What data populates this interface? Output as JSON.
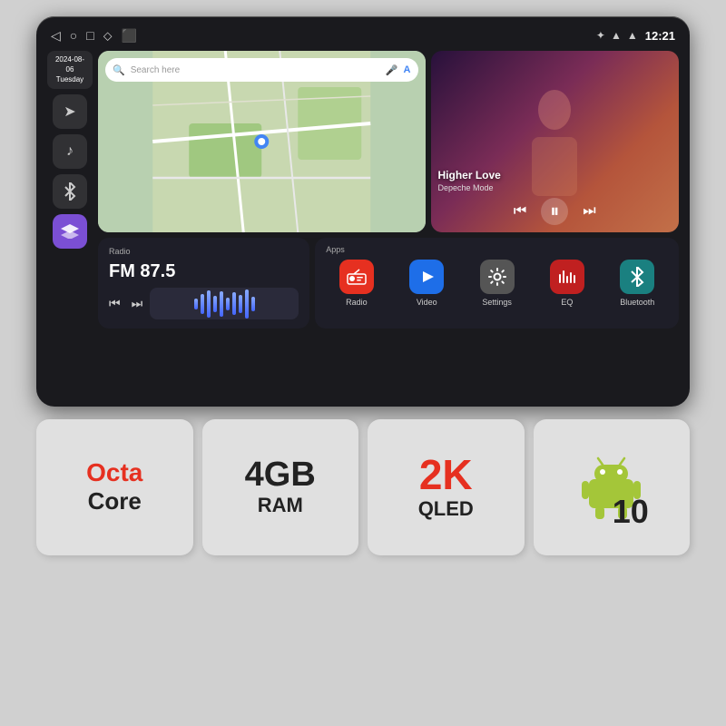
{
  "statusBar": {
    "time": "12:21",
    "navIcons": [
      "◁",
      "○",
      "□",
      "⬦",
      "⬛"
    ],
    "statusIcons": [
      "✦",
      "▲",
      "▲"
    ]
  },
  "sidebar": {
    "date": "2024-08-06",
    "dayName": "Tuesday",
    "buttons": [
      {
        "id": "send",
        "icon": "➤",
        "active": false
      },
      {
        "id": "music",
        "icon": "♪",
        "active": false
      },
      {
        "id": "bluetooth",
        "icon": "⚡",
        "active": false
      },
      {
        "id": "layers",
        "icon": "⧉",
        "active": true,
        "style": "purple"
      }
    ]
  },
  "map": {
    "searchPlaceholder": "Search here"
  },
  "music": {
    "title": "Higher Love",
    "artist": "Depeche Mode"
  },
  "radio": {
    "label": "Radio",
    "frequency": "FM 87.5"
  },
  "apps": {
    "label": "Apps",
    "items": [
      {
        "id": "radio",
        "label": "Radio",
        "colorClass": "red",
        "icon": "📻"
      },
      {
        "id": "video",
        "label": "Video",
        "colorClass": "blue",
        "icon": "▶"
      },
      {
        "id": "settings",
        "label": "Settings",
        "colorClass": "gray",
        "icon": "⚙"
      },
      {
        "id": "eq",
        "label": "EQ",
        "colorClass": "dark-red",
        "icon": "🎛"
      },
      {
        "id": "bluetooth",
        "label": "Bluetooth",
        "colorClass": "teal",
        "icon": "📞"
      }
    ]
  },
  "specs": [
    {
      "id": "octa",
      "line1": "Octa",
      "line2": "Core",
      "colorClass": "octa"
    },
    {
      "id": "ram",
      "line1": "4GB",
      "line2": "RAM",
      "colorClass": "ram"
    },
    {
      "id": "qled",
      "line1": "2K",
      "line2": "QLED",
      "colorClass": "qled"
    },
    {
      "id": "android",
      "line1": "Android",
      "line2": "10",
      "colorClass": "android"
    }
  ]
}
